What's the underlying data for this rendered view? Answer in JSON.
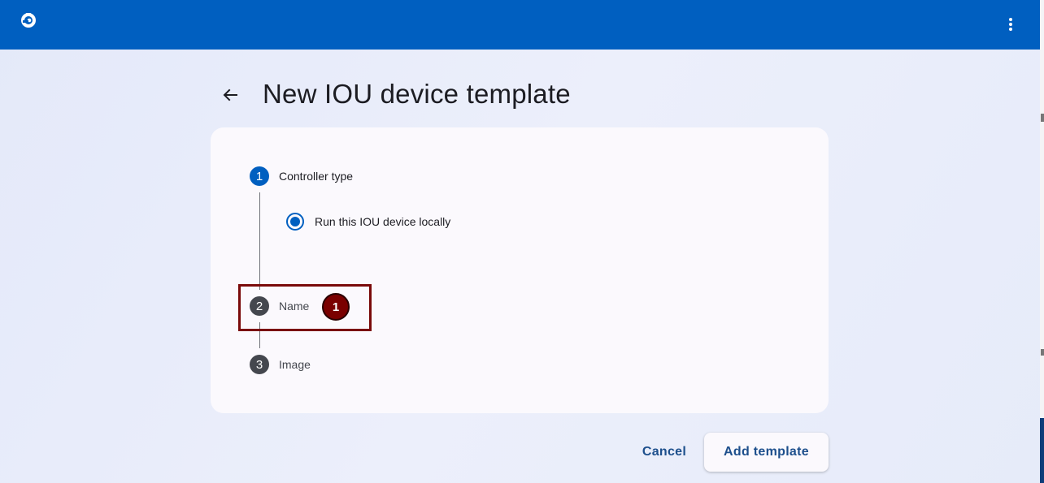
{
  "header": {
    "logo_icon": "chameleon-logo-icon",
    "menu_icon": "more-vert-icon",
    "bar_color": "#005fc0"
  },
  "page": {
    "back_icon": "arrow-back-icon",
    "title": "New IOU device template"
  },
  "stepper": {
    "steps": [
      {
        "number": "1",
        "label": "Controller type",
        "state": "active"
      },
      {
        "number": "2",
        "label": "Name",
        "state": "inactive"
      },
      {
        "number": "3",
        "label": "Image",
        "state": "inactive"
      }
    ],
    "controller_option": {
      "label": "Run this IOU device locally",
      "selected": true
    }
  },
  "annotation": {
    "badge": "1"
  },
  "actions": {
    "cancel_label": "Cancel",
    "add_label": "Add template"
  },
  "colors": {
    "accent": "#005fc0",
    "annotation": "#7a0000",
    "button_text": "#1d4f8c"
  }
}
